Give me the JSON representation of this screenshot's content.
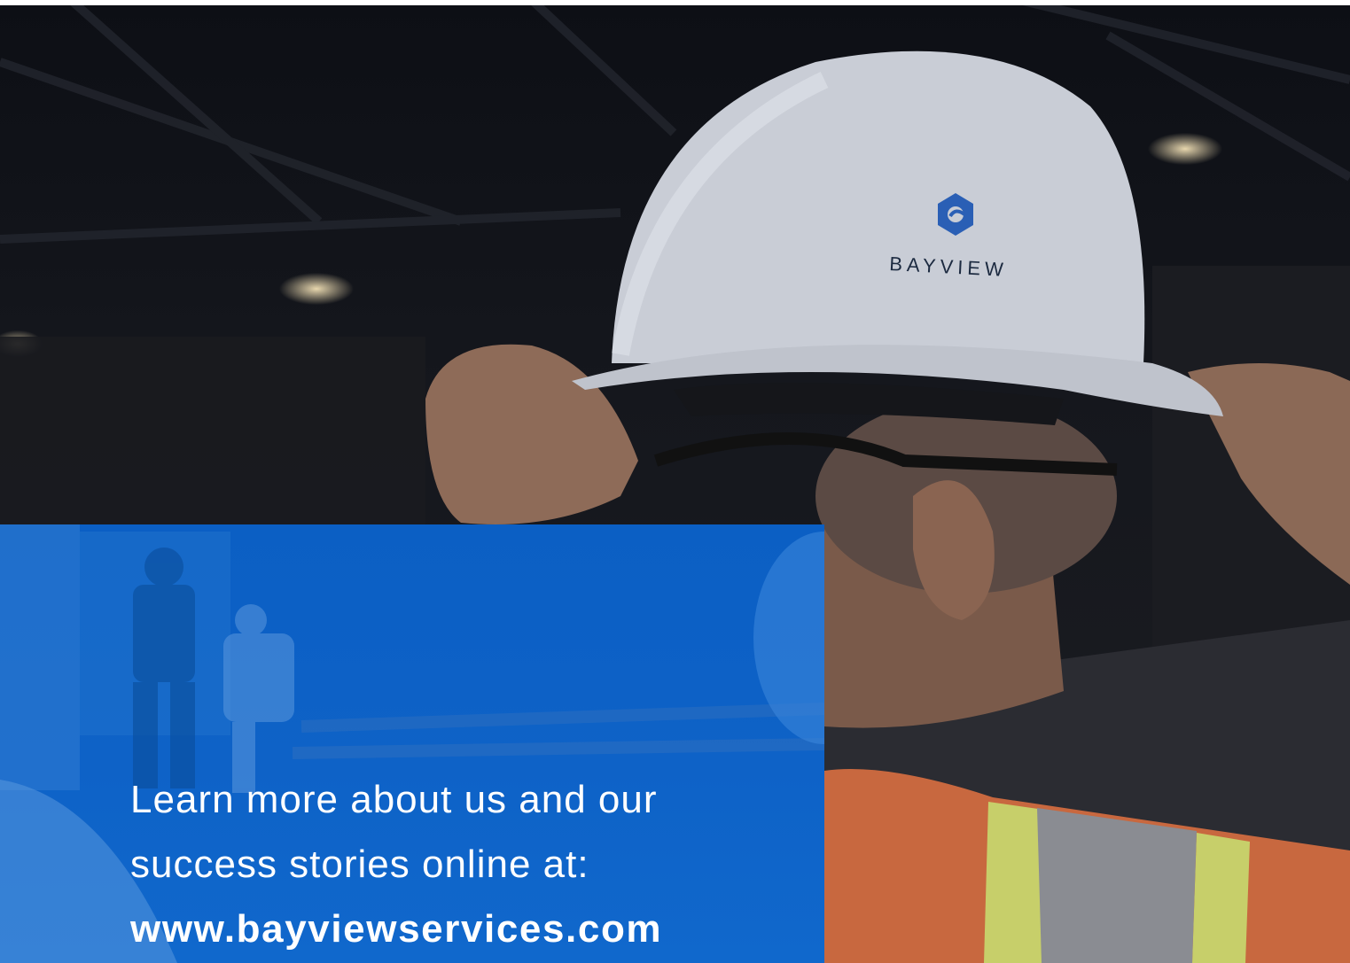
{
  "hero": {
    "helmet_logo_text": "BAYVIEW"
  },
  "panel": {
    "line1": "Learn more about us and our",
    "line2": "success stories online at:",
    "url": "www.bayviewservices.com"
  },
  "colors": {
    "brand_blue": "#0b5fc4",
    "panel_text": "#ffffff",
    "vest_orange": "#d66a38",
    "reflective_yellow": "#c9d36a"
  }
}
